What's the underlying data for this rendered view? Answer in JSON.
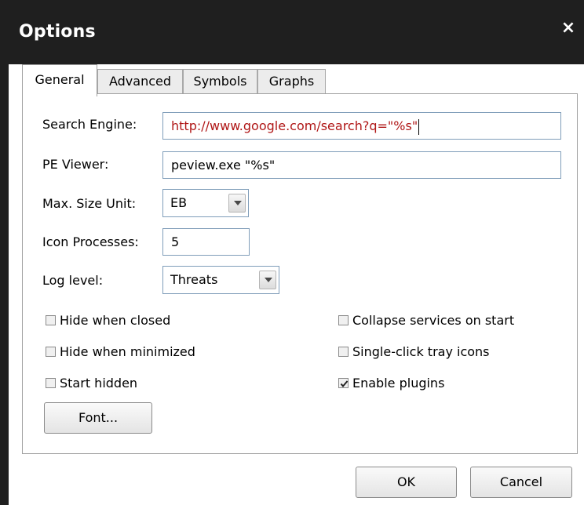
{
  "window": {
    "title": "Options",
    "close_glyph": "×"
  },
  "tabs": [
    {
      "label": "General",
      "active": true
    },
    {
      "label": "Advanced",
      "active": false
    },
    {
      "label": "Symbols",
      "active": false
    },
    {
      "label": "Graphs",
      "active": false
    }
  ],
  "general": {
    "search_engine": {
      "label": "Search Engine:",
      "value": "http://www.google.com/search?q=\"%s\""
    },
    "pe_viewer": {
      "label": "PE Viewer:",
      "value": "peview.exe \"%s\""
    },
    "max_size_unit": {
      "label": "Max. Size Unit:",
      "selected": "EB"
    },
    "icon_processes": {
      "label": "Icon Processes:",
      "value": "5"
    },
    "log_level": {
      "label": "Log level:",
      "selected": "Threats"
    },
    "checkboxes_left": [
      {
        "label": "Hide when closed",
        "checked": false
      },
      {
        "label": "Hide when minimized",
        "checked": false
      },
      {
        "label": "Start hidden",
        "checked": false
      }
    ],
    "checkboxes_right": [
      {
        "label": "Collapse services on start",
        "checked": false
      },
      {
        "label": "Single-click tray icons",
        "checked": false
      },
      {
        "label": "Enable plugins",
        "checked": true
      }
    ],
    "font_button": "Font..."
  },
  "footer": {
    "ok_label": "OK",
    "cancel_label": "Cancel"
  },
  "icons": {
    "close": "close-icon",
    "dropdown": "chevron-down-icon",
    "check": "check-icon"
  },
  "colors": {
    "titlebar": "#1f1f1f",
    "url_text": "#b01717",
    "input_border": "#7f9db9"
  }
}
